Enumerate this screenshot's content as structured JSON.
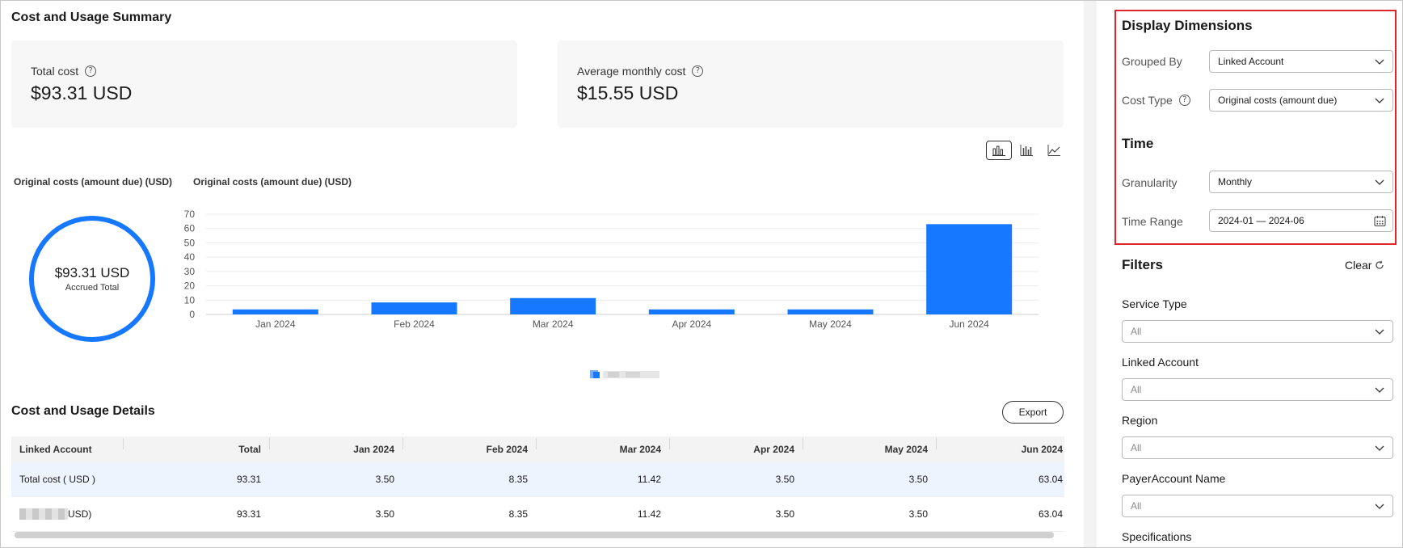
{
  "summary": {
    "title": "Cost and Usage Summary",
    "total_cost_label": "Total cost",
    "total_cost_value": "$93.31 USD",
    "avg_cost_label": "Average monthly cost",
    "avg_cost_value": "$15.55 USD"
  },
  "donut": {
    "caption": "Original costs (amount due) (USD)",
    "value": "$93.31 USD",
    "sublabel": "Accrued Total",
    "color": "#1677ff"
  },
  "chart_switch": {
    "icons": [
      "bar-chart-icon",
      "grouped-bar-chart-icon",
      "line-chart-icon"
    ],
    "active": "bar-chart-icon"
  },
  "chart_data": {
    "type": "bar",
    "title": "Original costs (amount due)  (USD)",
    "categories": [
      "Jan 2024",
      "Feb 2024",
      "Mar 2024",
      "Apr 2024",
      "May 2024",
      "Jun 2024"
    ],
    "values": [
      3.5,
      8.35,
      11.42,
      3.5,
      3.5,
      63.04
    ],
    "ylim": [
      0,
      70
    ],
    "yticks": [
      0,
      10,
      20,
      30,
      40,
      50,
      60,
      70
    ],
    "grid": true,
    "color": "#1677ff"
  },
  "details": {
    "title": "Cost and Usage Details",
    "export_label": "Export",
    "columns": [
      "Linked Account",
      "Total",
      "Jan 2024",
      "Feb 2024",
      "Mar 2024",
      "Apr 2024",
      "May 2024",
      "Jun 2024"
    ],
    "rows": [
      {
        "label": "Total cost ( USD )",
        "values": [
          "93.31",
          "3.50",
          "8.35",
          "11.42",
          "3.50",
          "3.50",
          "63.04"
        ]
      },
      {
        "label": "USD)",
        "values": [
          "93.31",
          "3.50",
          "8.35",
          "11.42",
          "3.50",
          "3.50",
          "63.04"
        ]
      }
    ]
  },
  "panel": {
    "display_title": "Display Dimensions",
    "grouped_by_label": "Grouped By",
    "grouped_by_value": "Linked Account",
    "cost_type_label": "Cost Type",
    "cost_type_value": "Original costs (amount due)",
    "time_title": "Time",
    "granularity_label": "Granularity",
    "granularity_value": "Monthly",
    "time_range_label": "Time Range",
    "time_range_value": "2024-01 — 2024-06",
    "filters_title": "Filters",
    "clear_label": "Clear",
    "filters": [
      {
        "label": "Service Type",
        "value": "All"
      },
      {
        "label": "Linked Account",
        "value": "All"
      },
      {
        "label": "Region",
        "value": "All"
      },
      {
        "label": "PayerAccount Name",
        "value": "All"
      },
      {
        "label": "Specifications",
        "value": ""
      }
    ],
    "highlight_color": "#e0262b"
  }
}
